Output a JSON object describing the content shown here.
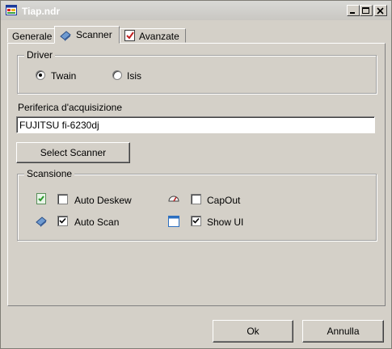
{
  "window": {
    "title": "Tiap.ndr"
  },
  "tabs": [
    {
      "label": "Generale",
      "icon": "none",
      "active": false
    },
    {
      "label": "Scanner",
      "icon": "scanner-icon",
      "active": true
    },
    {
      "label": "Avanzate",
      "icon": "checklist-icon",
      "active": false
    }
  ],
  "driver": {
    "legend": "Driver",
    "options": [
      {
        "label": "Twain",
        "selected": true
      },
      {
        "label": "Isis",
        "selected": false
      }
    ]
  },
  "device": {
    "label": "Periferica d'acquisizione",
    "value": "FUJITSU fi-6230dj"
  },
  "select_scanner_button": "Select Scanner",
  "scansione": {
    "legend": "Scansione",
    "options": [
      {
        "label": "Auto Deskew",
        "checked": false,
        "icon": "deskew-icon"
      },
      {
        "label": "CapOut",
        "checked": false,
        "icon": "gauge-icon"
      },
      {
        "label": "Auto Scan",
        "checked": true,
        "icon": "scanner-icon"
      },
      {
        "label": "Show UI",
        "checked": true,
        "icon": "window-icon"
      }
    ]
  },
  "footer": {
    "ok": "Ok",
    "cancel": "Annulla"
  },
  "colors": {
    "face": "#d4d0c8",
    "title_text": "#ffffff"
  }
}
